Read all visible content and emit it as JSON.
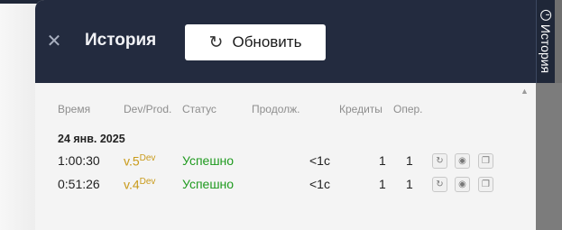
{
  "side_tab": {
    "label": "История"
  },
  "header": {
    "title": "История",
    "refresh_label": "Обновить"
  },
  "table": {
    "columns": [
      "Время",
      "Dev/Prod.",
      "Статус",
      "Продолж.",
      "Кредиты",
      "Опер."
    ],
    "groups": [
      {
        "date": "24 янв. 2025",
        "rows": [
          {
            "time": "1:00:30",
            "version": "v.5",
            "env": "Dev",
            "status": "Успешно",
            "duration": "<1с",
            "credits": "1",
            "ops": "1"
          },
          {
            "time": "0:51:26",
            "version": "v.4",
            "env": "Dev",
            "status": "Успешно",
            "duration": "<1с",
            "credits": "1",
            "ops": "1"
          }
        ]
      }
    ]
  },
  "icons": [
    "close-icon",
    "refresh-icon",
    "history-icon",
    "rerun-icon",
    "view-icon",
    "copy-icon",
    "scroll-up-icon"
  ],
  "colors": {
    "header_bg": "#232b3f",
    "version": "#c99a1a",
    "success": "#1f9a1f"
  }
}
